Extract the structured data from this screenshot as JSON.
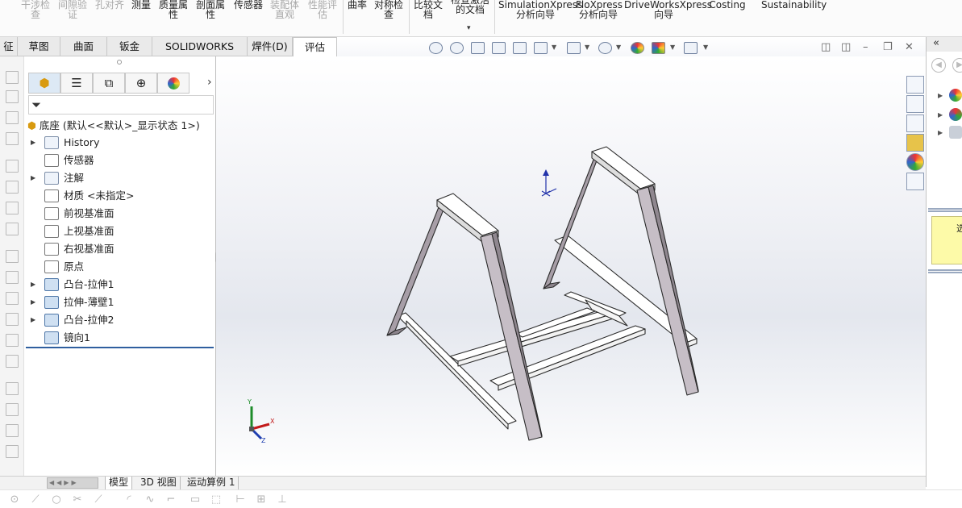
{
  "ribbon": {
    "items": [
      {
        "label": "干涉检\n查",
        "disabled": true
      },
      {
        "label": "间隙验\n证",
        "disabled": true
      },
      {
        "label": "孔对齐",
        "disabled": true
      },
      {
        "label": "测量",
        "disabled": false
      },
      {
        "label": "质量属\n性",
        "disabled": false
      },
      {
        "label": "剖面属\n性",
        "disabled": false
      },
      {
        "label": "传感器",
        "disabled": false
      },
      {
        "label": "装配体\n直观",
        "disabled": true
      },
      {
        "label": "性能评\n估",
        "disabled": true
      },
      {
        "label": "曲率",
        "disabled": false
      },
      {
        "label": "对称检\n查",
        "disabled": false
      },
      {
        "label": "比较文\n档",
        "disabled": false
      },
      {
        "label": "检查激活\n的文档",
        "disabled": false
      },
      {
        "label": "SimulationXpress\n分析向导",
        "disabled": false
      },
      {
        "label": "FloXpress\n分析向导",
        "disabled": false
      },
      {
        "label": "DriveWorksXpress\n向导",
        "disabled": false
      },
      {
        "label": "Costing",
        "disabled": false
      },
      {
        "label": "Sustainability",
        "disabled": false
      }
    ]
  },
  "tabs": [
    {
      "label": "征",
      "active": false
    },
    {
      "label": "草图",
      "active": false
    },
    {
      "label": "曲面",
      "active": false
    },
    {
      "label": "钣金",
      "active": false
    },
    {
      "label": "SOLIDWORKS MBD",
      "active": false
    },
    {
      "label": "焊件(D)",
      "active": false
    },
    {
      "label": "评估",
      "active": true
    }
  ],
  "feature_tree": {
    "root": "底座 (默认<<默认>_显示状态 1>)",
    "items": [
      {
        "label": "History",
        "expandable": true,
        "icon": "history-icon"
      },
      {
        "label": "传感器",
        "expandable": false,
        "icon": "sensor-icon"
      },
      {
        "label": "注解",
        "expandable": true,
        "icon": "annotation-icon"
      },
      {
        "label": "材质 <未指定>",
        "expandable": false,
        "icon": "material-icon"
      },
      {
        "label": "前视基准面",
        "expandable": false,
        "icon": "plane-icon"
      },
      {
        "label": "上视基准面",
        "expandable": false,
        "icon": "plane-icon"
      },
      {
        "label": "右视基准面",
        "expandable": false,
        "icon": "plane-icon"
      },
      {
        "label": "原点",
        "expandable": false,
        "icon": "origin-icon"
      },
      {
        "label": "凸台-拉伸1",
        "expandable": true,
        "icon": "extrude-icon"
      },
      {
        "label": "拉伸-薄壁1",
        "expandable": true,
        "icon": "extrude-icon"
      },
      {
        "label": "凸台-拉伸2",
        "expandable": true,
        "icon": "extrude-icon"
      },
      {
        "label": "镜向1",
        "expandable": false,
        "icon": "mirror-icon"
      }
    ]
  },
  "triad": {
    "x": "X",
    "y": "Y",
    "z": "Z"
  },
  "bottom_tabs": [
    {
      "label": "模型",
      "active": true
    },
    {
      "label": "3D 视图",
      "active": false
    },
    {
      "label": "运动算例 1",
      "active": false
    }
  ],
  "task_pane": {
    "collapse_label": "«",
    "note_text": "选"
  },
  "colors": {
    "accent": "#2f5f9f",
    "tree_icon": "#4f77a8",
    "model_face": "#a79ea7"
  }
}
